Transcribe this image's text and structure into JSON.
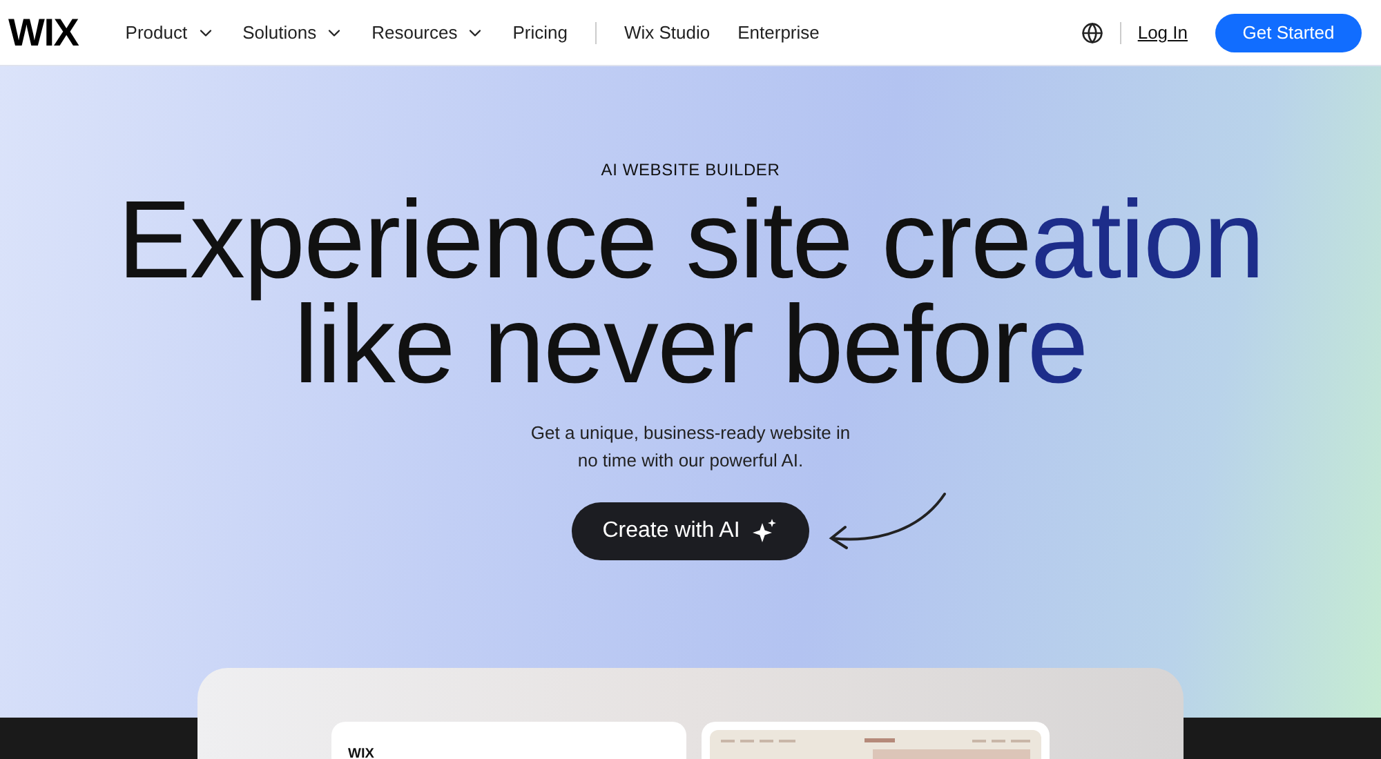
{
  "nav": {
    "logo": "WIX",
    "items": [
      {
        "label": "Product",
        "dropdown": true
      },
      {
        "label": "Solutions",
        "dropdown": true
      },
      {
        "label": "Resources",
        "dropdown": true
      },
      {
        "label": "Pricing",
        "dropdown": false
      }
    ],
    "secondary_items": [
      "Wix Studio",
      "Enterprise"
    ],
    "login": "Log In",
    "cta": "Get Started"
  },
  "hero": {
    "eyebrow": "AI WEBSITE BUILDER",
    "headline": [
      [
        {
          "text": "Experience site cre",
          "accent": false
        },
        {
          "text": "ation",
          "accent": true
        }
      ],
      [
        {
          "text": "like never befor",
          "accent": false
        },
        {
          "text": "e",
          "accent": true
        }
      ]
    ],
    "subtitle": "Get a unique, business-ready website in no time with our powerful AI.",
    "button": "Create with AI"
  },
  "preview": {
    "left_card_logo": "WIX"
  }
}
